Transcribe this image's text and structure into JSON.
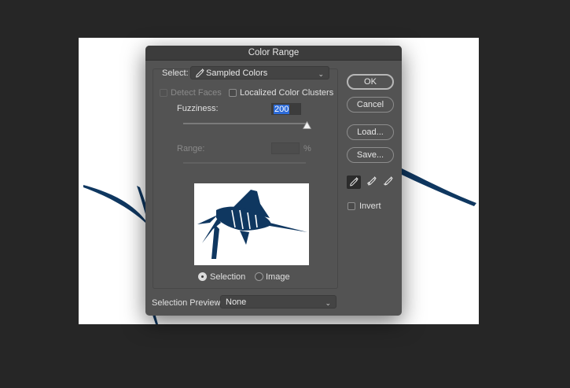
{
  "dialog": {
    "title": "Color Range"
  },
  "select": {
    "label": "Select:",
    "value": "Sampled Colors"
  },
  "options": {
    "detect_faces": {
      "label": "Detect Faces",
      "checked": false,
      "enabled": false
    },
    "localized_clusters": {
      "label": "Localized Color Clusters",
      "checked": false
    }
  },
  "fuzziness": {
    "label": "Fuzziness:",
    "value": "200",
    "level": 1.0
  },
  "range": {
    "label": "Range:",
    "value": "",
    "unit": "%"
  },
  "preview_mode": {
    "selected": "Selection",
    "options": [
      {
        "label": "Selection"
      },
      {
        "label": "Image"
      }
    ]
  },
  "selection_preview": {
    "label": "Selection Preview:",
    "value": "None"
  },
  "buttons": {
    "ok": "OK",
    "cancel": "Cancel",
    "load": "Load...",
    "save": "Save..."
  },
  "eyedroppers": [
    "eyedropper-icon",
    "eyedropper-plus-icon",
    "eyedropper-minus-icon"
  ],
  "invert": {
    "label": "Invert",
    "checked": false
  },
  "colors": {
    "marlin": "#0f3760",
    "dialog_bg": "#535353",
    "highlight": "#2d6bd8"
  }
}
